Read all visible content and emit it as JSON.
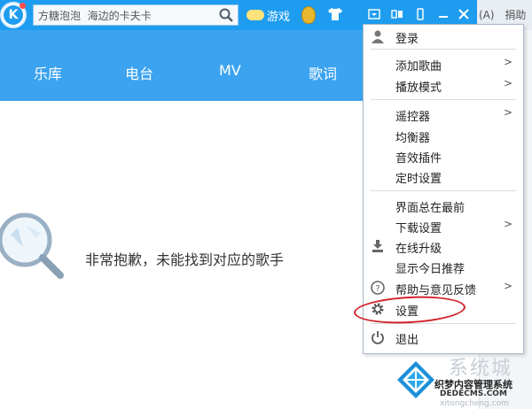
{
  "titlebar": {
    "search_value": "方糖泡泡  海边的卡夫卡",
    "game_label": "游戏",
    "corner_label": "(A)",
    "donate_label": "捐助"
  },
  "nav": {
    "items": [
      "乐库",
      "电台",
      "MV",
      "歌词"
    ]
  },
  "content": {
    "empty_message": "非常抱歉，未能找到对应的歌手"
  },
  "menu": {
    "items": [
      {
        "label": "登录",
        "icon": "user-icon"
      },
      {
        "label": "添加歌曲",
        "submenu": true
      },
      {
        "label": "播放模式",
        "submenu": true
      },
      {
        "label": "遥控器",
        "submenu": true
      },
      {
        "label": "均衡器"
      },
      {
        "label": "音效插件"
      },
      {
        "label": "定时设置"
      },
      {
        "label": "界面总在最前"
      },
      {
        "label": "下载设置",
        "submenu": true
      },
      {
        "label": "在线升级",
        "icon": "download-icon"
      },
      {
        "label": "显示今日推荐"
      },
      {
        "label": "帮助与意见反馈",
        "icon": "help-icon",
        "submenu": true
      },
      {
        "label": "设置",
        "icon": "gear-icon",
        "highlighted": true
      },
      {
        "label": "退出",
        "icon": "power-icon"
      }
    ],
    "arrow": ">"
  },
  "watermark": {
    "title": "系统城",
    "subtitle": "织梦内容管理系统",
    "domain": "DEDECMS.COM",
    "url": "xitongcheng.com"
  },
  "colors": {
    "titlebar": "#1e9df0",
    "nav": "#3ba3f0",
    "highlight_oval": "#d2232a"
  }
}
